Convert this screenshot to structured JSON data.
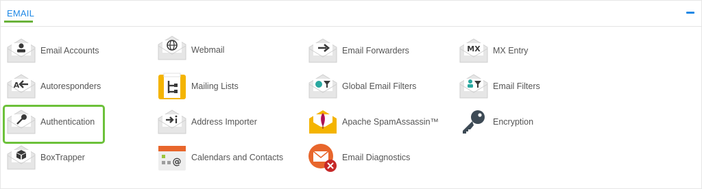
{
  "section": {
    "title": "EMAIL",
    "collapse_icon": "minus-icon"
  },
  "items": [
    {
      "label": "Email Accounts",
      "icon": "user-envelope-icon"
    },
    {
      "label": "Webmail",
      "icon": "globe-envelope-icon"
    },
    {
      "label": "Email Forwarders",
      "icon": "arrow-envelope-icon"
    },
    {
      "label": "MX Entry",
      "icon": "mx-envelope-icon"
    },
    {
      "label": "Autoresponders",
      "icon": "autoresponder-envelope-icon"
    },
    {
      "label": "Mailing Lists",
      "icon": "mailing-list-icon"
    },
    {
      "label": "Global Email Filters",
      "icon": "globe-filter-envelope-icon"
    },
    {
      "label": "Email Filters",
      "icon": "user-filter-envelope-icon"
    },
    {
      "label": "Authentication",
      "icon": "key-envelope-icon"
    },
    {
      "label": "Address Importer",
      "icon": "import-envelope-icon"
    },
    {
      "label": "Apache SpamAssassin™",
      "icon": "feather-envelope-icon"
    },
    {
      "label": "Encryption",
      "icon": "key-icon"
    },
    {
      "label": "BoxTrapper",
      "icon": "box-envelope-icon"
    },
    {
      "label": "Calendars and Contacts",
      "icon": "calendar-icon"
    },
    {
      "label": "Email Diagnostics",
      "icon": "email-diagnostics-icon"
    }
  ],
  "highlighted_item": "Authentication",
  "colors": {
    "accent_blue": "#1e88e5",
    "accent_green": "#6ab23a",
    "highlight_border": "#6cc13a",
    "icon_envelope": "#e6e6e6",
    "icon_dark": "#3a3a3a",
    "teal": "#2aa8a0",
    "amber": "#f4b400",
    "orange": "#e8662c",
    "red": "#c62828"
  }
}
